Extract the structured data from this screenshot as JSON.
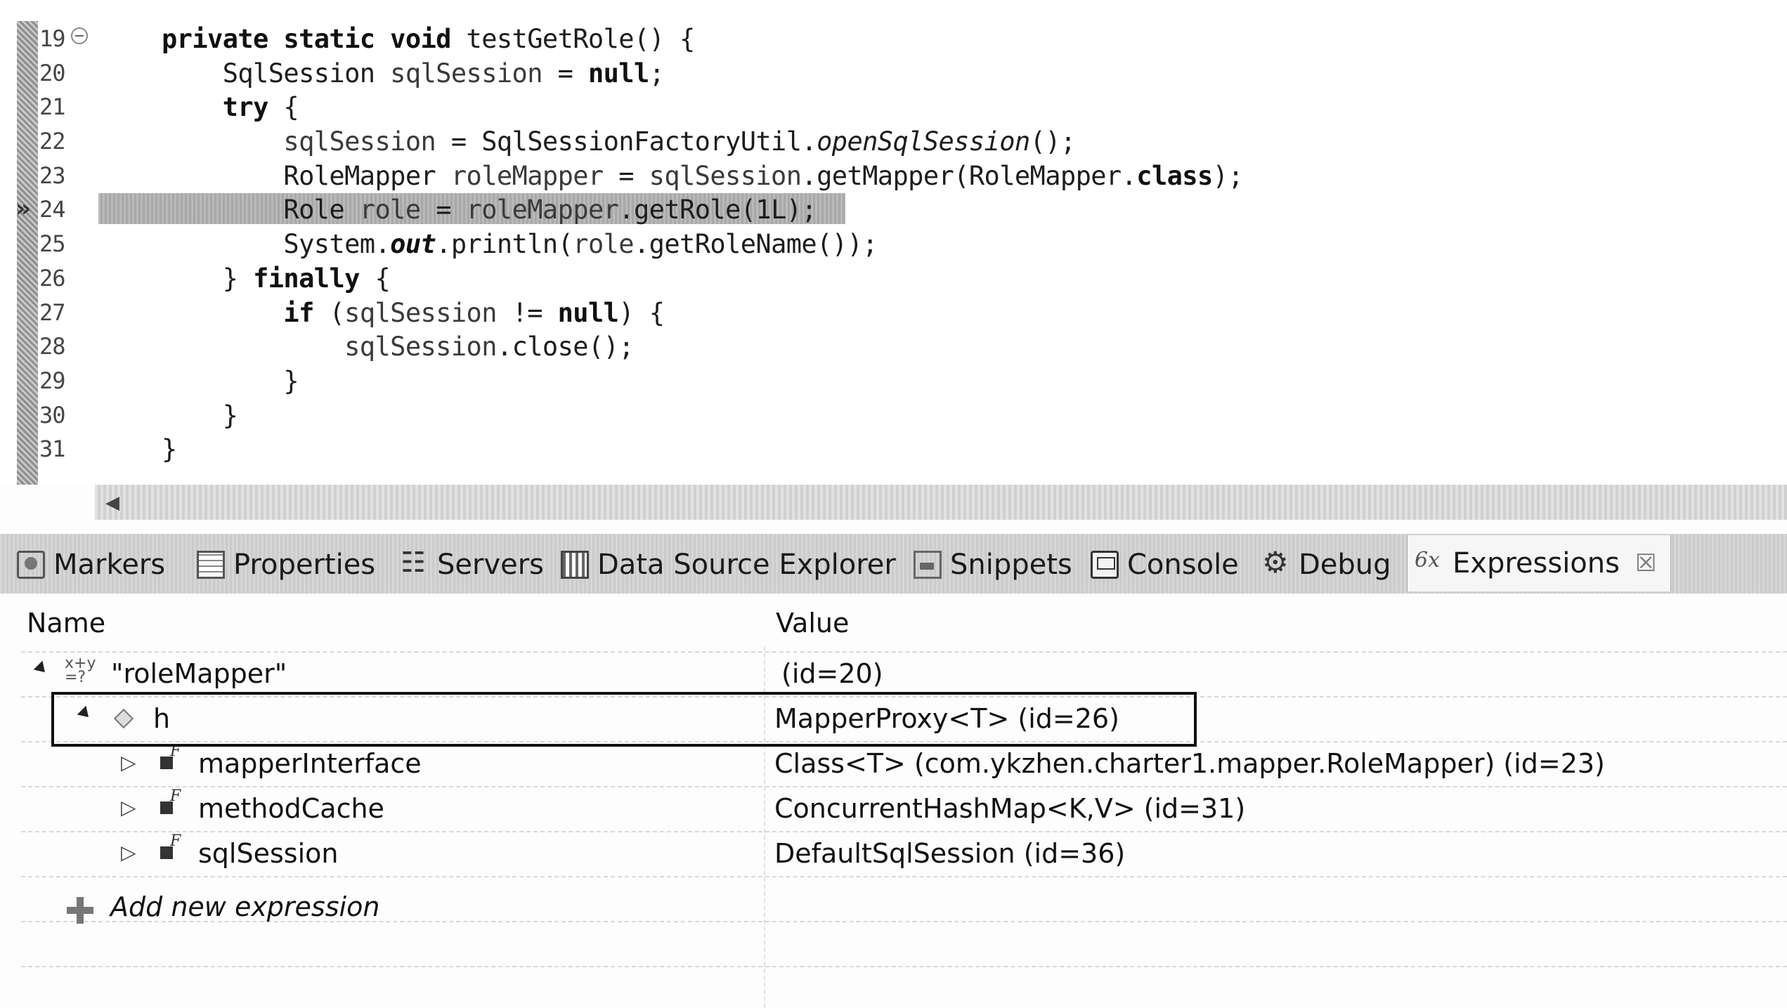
{
  "editor": {
    "lines": [
      {
        "num": "19",
        "code": "    private static void testGetRole() {"
      },
      {
        "num": "20",
        "code": "        SqlSession sqlSession = null;"
      },
      {
        "num": "21",
        "code": "        try {"
      },
      {
        "num": "22",
        "code": "            sqlSession = SqlSessionFactoryUtil.openSqlSession();"
      },
      {
        "num": "23",
        "code": "            RoleMapper roleMapper = sqlSession.getMapper(RoleMapper.class);"
      },
      {
        "num": "24",
        "code": "            Role role = roleMapper.getRole(1L);"
      },
      {
        "num": "25",
        "code": "            System.out.println(role.getRoleName());"
      },
      {
        "num": "26",
        "code": "        } finally {"
      },
      {
        "num": "27",
        "code": "            if (sqlSession != null) {"
      },
      {
        "num": "28",
        "code": "                sqlSession.close();"
      },
      {
        "num": "29",
        "code": "            }"
      },
      {
        "num": "30",
        "code": "        }"
      },
      {
        "num": "31",
        "code": "    }"
      }
    ],
    "current_line": "24",
    "current_line_marker": "»"
  },
  "tabs": [
    {
      "label": "Markers",
      "icon": "markers-icon"
    },
    {
      "label": "Properties",
      "icon": "properties-icon"
    },
    {
      "label": "Servers",
      "icon": "servers-icon"
    },
    {
      "label": "Data Source Explorer",
      "icon": "data-source-explorer-icon"
    },
    {
      "label": "Snippets",
      "icon": "snippets-icon"
    },
    {
      "label": "Console",
      "icon": "console-icon"
    },
    {
      "label": "Debug",
      "icon": "debug-icon"
    },
    {
      "label": "Expressions",
      "icon": "expressions-icon",
      "active": true
    }
  ],
  "tab_close": "☒",
  "expressions": {
    "headers": {
      "name": "Name",
      "value": "Value"
    },
    "rows": [
      {
        "name": "\"roleMapper\"",
        "value": "(id=20)",
        "expanded": true,
        "icon_text": "x+y\n=?"
      },
      {
        "name": "h",
        "value": "MapperProxy<T>  (id=26)",
        "expanded": true
      },
      {
        "name": "mapperInterface",
        "value": "Class<T> (com.ykzhen.charter1.mapper.RoleMapper) (id=23)",
        "expanded": false
      },
      {
        "name": "methodCache",
        "value": "ConcurrentHashMap<K,V>  (id=31)",
        "expanded": false
      },
      {
        "name": "sqlSession",
        "value": "DefaultSqlSession  (id=36)",
        "expanded": false
      }
    ],
    "add_label": "Add new expression"
  }
}
